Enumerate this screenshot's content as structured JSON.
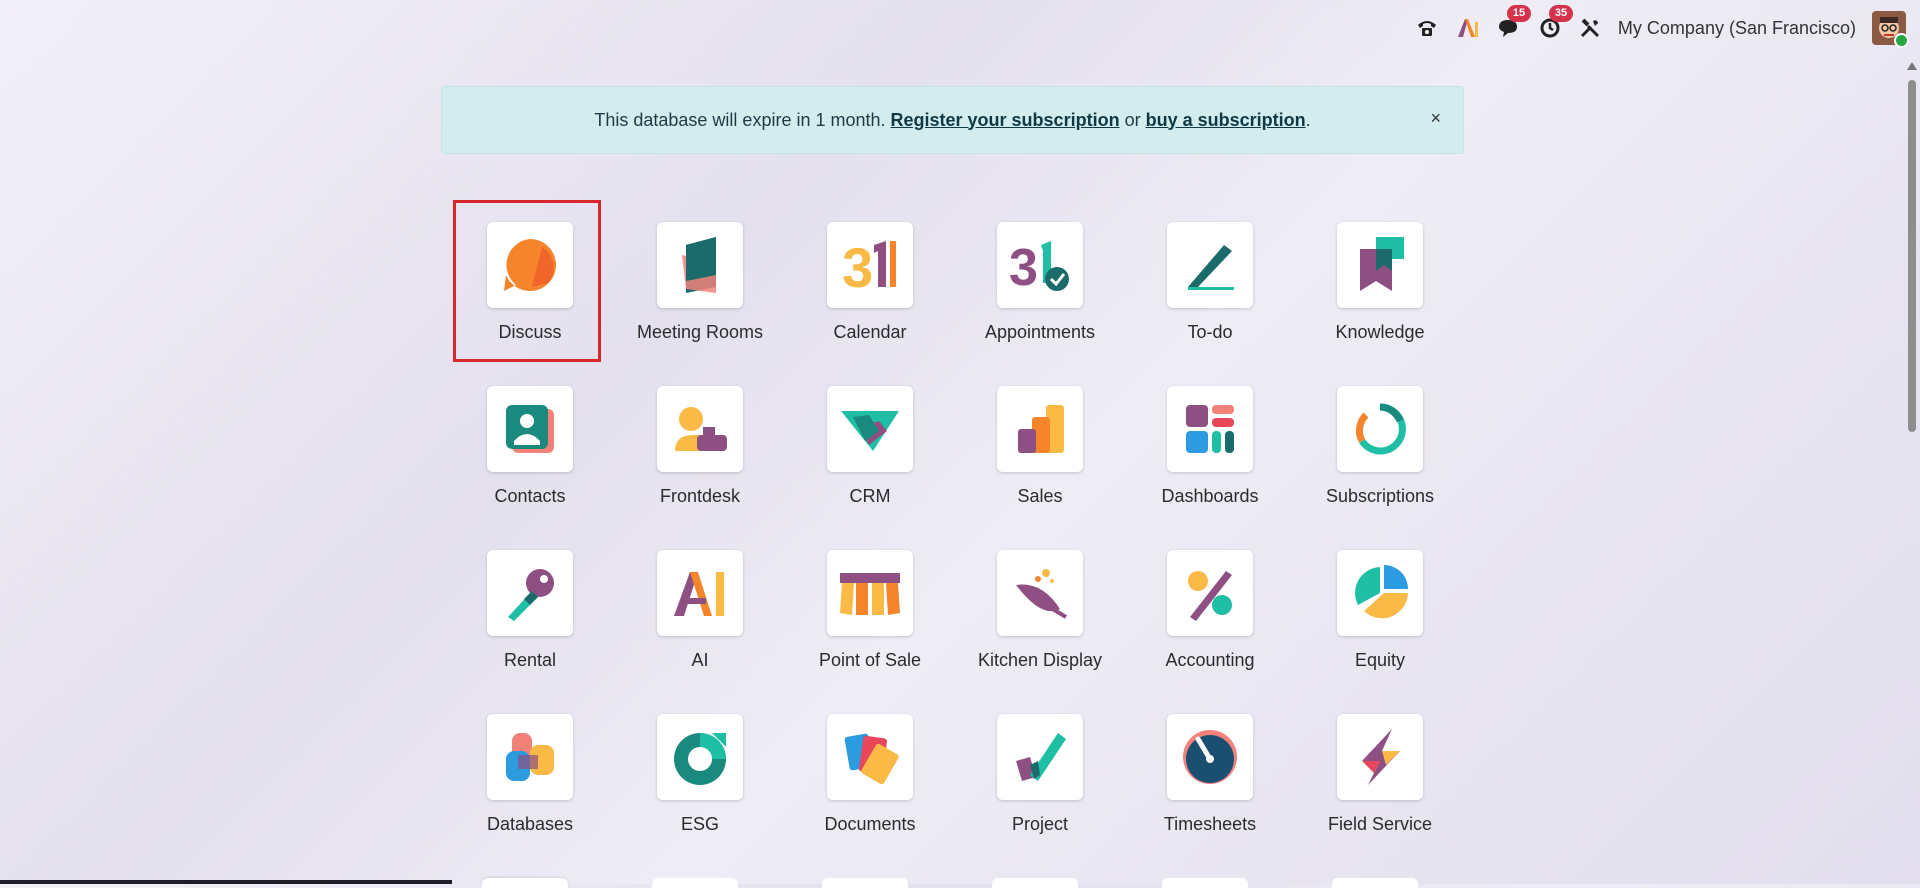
{
  "systray": {
    "phone_icon": "phone-icon",
    "ai_icon": "ai-icon",
    "messages_count": "15",
    "activities_count": "35",
    "tools_icon": "tools-icon",
    "company": "My Company (San Francisco)"
  },
  "banner": {
    "text_before": "This database will expire in 1 month. ",
    "register_link": "Register your subscription",
    "or_text": " or ",
    "buy_link": "buy a subscription",
    "period": ".",
    "close": "×"
  },
  "apps": [
    {
      "label": "Discuss",
      "icon": "discuss-icon"
    },
    {
      "label": "Meeting Rooms",
      "icon": "meeting-rooms-icon"
    },
    {
      "label": "Calendar",
      "icon": "calendar-icon"
    },
    {
      "label": "Appointments",
      "icon": "appointments-icon"
    },
    {
      "label": "To-do",
      "icon": "todo-icon"
    },
    {
      "label": "Knowledge",
      "icon": "knowledge-icon"
    },
    {
      "label": "Contacts",
      "icon": "contacts-icon"
    },
    {
      "label": "Frontdesk",
      "icon": "frontdesk-icon"
    },
    {
      "label": "CRM",
      "icon": "crm-icon"
    },
    {
      "label": "Sales",
      "icon": "sales-icon"
    },
    {
      "label": "Dashboards",
      "icon": "dashboards-icon"
    },
    {
      "label": "Subscriptions",
      "icon": "subscriptions-icon"
    },
    {
      "label": "Rental",
      "icon": "rental-icon"
    },
    {
      "label": "AI",
      "icon": "ai-app-icon"
    },
    {
      "label": "Point of Sale",
      "icon": "point-of-sale-icon"
    },
    {
      "label": "Kitchen Display",
      "icon": "kitchen-display-icon"
    },
    {
      "label": "Accounting",
      "icon": "accounting-icon"
    },
    {
      "label": "Equity",
      "icon": "equity-icon"
    },
    {
      "label": "Databases",
      "icon": "databases-icon"
    },
    {
      "label": "ESG",
      "icon": "esg-icon"
    },
    {
      "label": "Documents",
      "icon": "documents-icon"
    },
    {
      "label": "Project",
      "icon": "project-icon"
    },
    {
      "label": "Timesheets",
      "icon": "timesheets-icon"
    },
    {
      "label": "Field Service",
      "icon": "field-service-icon"
    }
  ],
  "colors": {
    "orange": "#f5842b",
    "teal": "#1ebfa5",
    "dark_teal": "#1b6b6b",
    "purple": "#8e4f82",
    "yellow": "#fbb945",
    "pink": "#f2817a",
    "red": "#e8465a",
    "blue": "#2c9be0",
    "selection_border": "#d9252c"
  }
}
